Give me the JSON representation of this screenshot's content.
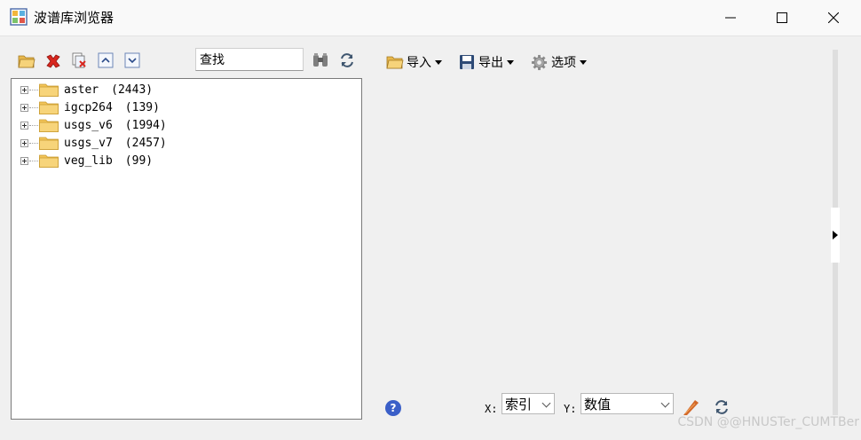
{
  "window": {
    "title": "波谱库浏览器"
  },
  "toolbar": {
    "left_icons": [
      "open-folder-icon",
      "delete-icon",
      "remove-library-icon",
      "move-up-icon",
      "move-down-icon"
    ],
    "search_text": "查找",
    "search_icons": [
      "binoculars-icon",
      "refresh-icon"
    ]
  },
  "tree": {
    "items": [
      {
        "name": "aster",
        "count": "(2443)"
      },
      {
        "name": "igcp264",
        "count": "(139)"
      },
      {
        "name": "usgs_v6",
        "count": "(1994)"
      },
      {
        "name": "usgs_v7",
        "count": "(2457)"
      },
      {
        "name": "veg_lib",
        "count": "(99)"
      }
    ]
  },
  "right_toolbar": {
    "import_label": "导入",
    "export_label": "导出",
    "options_label": "选项"
  },
  "bottom": {
    "help_icon": "?",
    "x_label": "X:",
    "x_value": "索引",
    "y_label": "Y:",
    "y_value": "数值"
  },
  "watermark": "CSDN @@HNUSTer_CUMTBer",
  "colors": {
    "folder": "#f3c55a",
    "delete_red": "#d8261e",
    "accent_blue": "#3a5fc8"
  }
}
